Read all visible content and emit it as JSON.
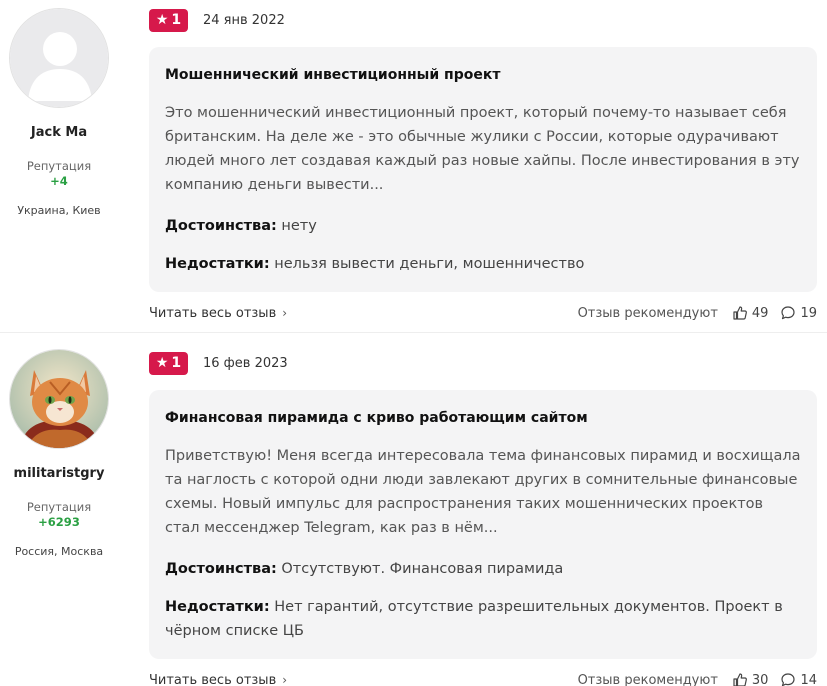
{
  "reviews": [
    {
      "author": {
        "name": "Jack Ma",
        "reputation_label": "Репутация",
        "reputation_value": "+4",
        "location": "Украина, Киев"
      },
      "rating": "1",
      "date": "24 янв 2022",
      "title": "Мошеннический инвестиционный проект",
      "text": "Это мошеннический инвестиционный проект, который почему-то называет себя британским. На деле же - это обычные жулики с России, которые одурачивают людей много лет создавая каждый раз новые хайпы. После инвестирования в эту компанию деньги вывести...",
      "pros_label": "Достоинства:",
      "pros": "нету",
      "cons_label": "Недостатки:",
      "cons": "нельзя вывести деньги, мошенничество",
      "read_more": "Читать весь отзыв",
      "recommend_label": "Отзыв рекомендуют",
      "likes": "49",
      "comments": "19"
    },
    {
      "author": {
        "name": "militaristgry",
        "reputation_label": "Репутация",
        "reputation_value": "+6293",
        "location": "Россия, Москва"
      },
      "rating": "1",
      "date": "16 фев 2023",
      "title": "Финансовая пирамида с криво работающим сайтом",
      "text": "Приветствую! Меня всегда интересовала тема финансовых пирамид и восхищала та наглость с которой одни люди завлекают других в сомнительные финансовые схемы. Новый импульс для распространения таких мошеннических проектов стал мессенджер Telegram, как раз в нём...",
      "pros_label": "Достоинства:",
      "pros": "Отсутствуют. Финансовая пирамида",
      "cons_label": "Недостатки:",
      "cons": "Нет гарантий, отсутствие разрешительных документов. Проект в чёрном списке ЦБ",
      "read_more": "Читать весь отзыв",
      "recommend_label": "Отзыв рекомендуют",
      "likes": "30",
      "comments": "14"
    }
  ],
  "icons": {
    "star": "star-icon",
    "chevron": "chevron-right-icon",
    "like": "thumbs-up-icon",
    "comment": "comment-icon",
    "avatar_default": "default-user-avatar",
    "avatar_cat": "cat-avatar"
  },
  "colors": {
    "badge": "#d6194b",
    "reputation": "#2aa043",
    "card_bg": "#f4f4f5"
  }
}
